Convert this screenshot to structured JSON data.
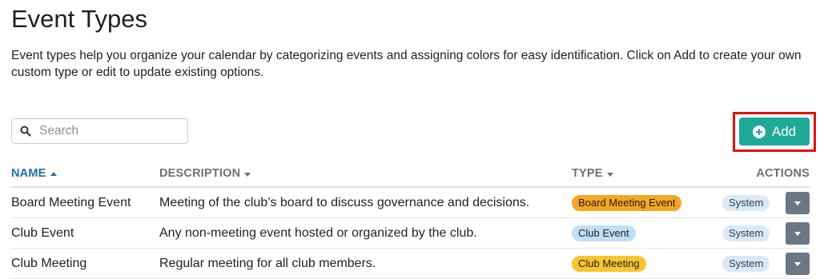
{
  "page": {
    "title": "Event Types",
    "description": "Event types help you organize your calendar by categorizing events and assigning colors for easy identification. Click on Add to create your own custom type or edit to update existing options."
  },
  "search": {
    "placeholder": "Search",
    "value": ""
  },
  "toolbar": {
    "add_label": "Add",
    "add_color": "#1ea99b",
    "highlight_color": "#e31010"
  },
  "table": {
    "columns": {
      "name": "NAME",
      "description": "DESCRIPTION",
      "type": "TYPE",
      "actions": "ACTIONS"
    },
    "sort": {
      "column": "name",
      "direction": "ascending"
    },
    "rows": [
      {
        "name": "Board Meeting Event",
        "description": "Meeting of the club’s board to discuss governance and decisions.",
        "type": "Board Meeting Event",
        "type_color": "#f5a623",
        "badge": "System"
      },
      {
        "name": "Club Event",
        "description": "Any non-meeting event hosted or organized by the club.",
        "type": "Club Event",
        "type_color": "#bfe0f7",
        "badge": "System"
      },
      {
        "name": "Club Meeting",
        "description": "Regular meeting for all club members.",
        "type": "Club Meeting",
        "type_color": "#f7c62f",
        "badge": "System"
      }
    ]
  }
}
